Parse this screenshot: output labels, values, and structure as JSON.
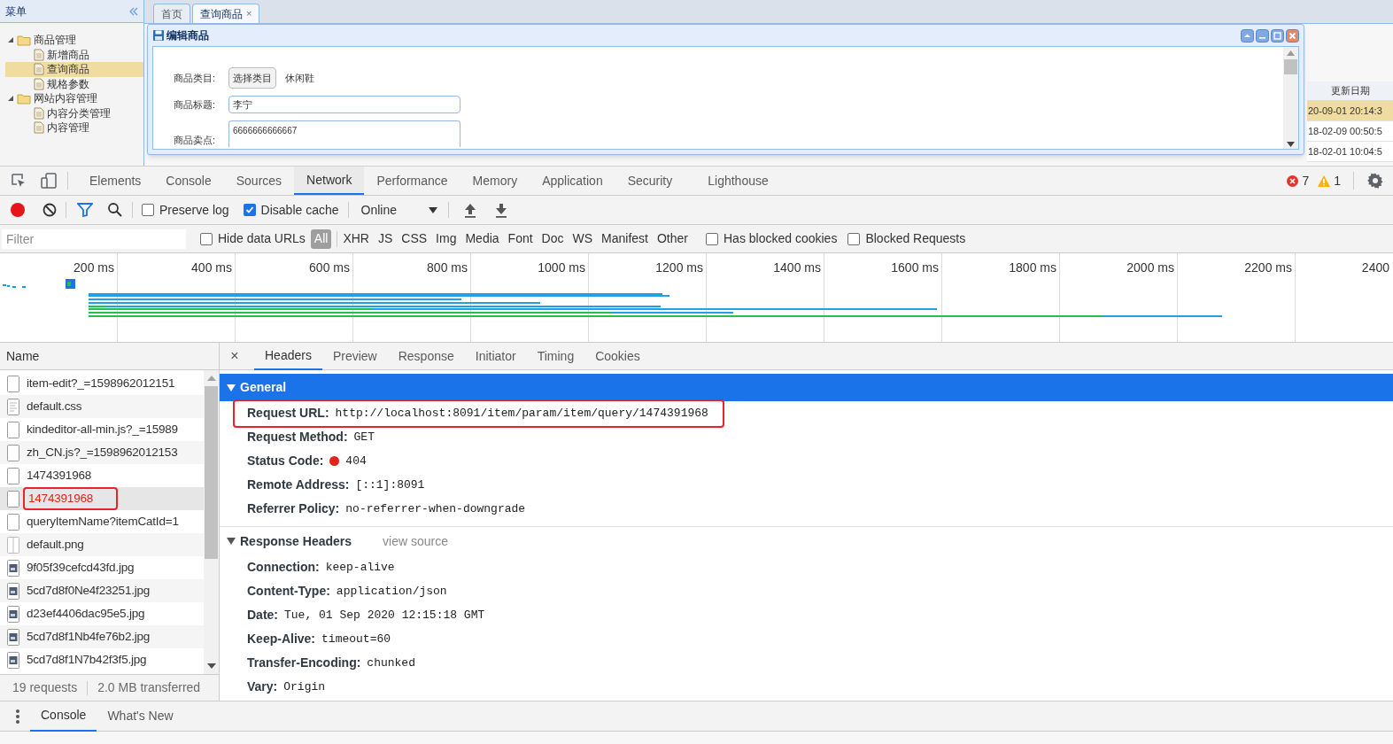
{
  "app": {
    "menu": {
      "title": "菜单"
    },
    "tree": [
      {
        "label": "商品管理",
        "expanded": true,
        "selected": false,
        "children": [
          {
            "label": "新增商品",
            "selected": false
          },
          {
            "label": "查询商品",
            "selected": true
          },
          {
            "label": "规格参数",
            "selected": false
          }
        ]
      },
      {
        "label": "网站内容管理",
        "expanded": true,
        "selected": false,
        "children": [
          {
            "label": "内容分类管理",
            "selected": false
          },
          {
            "label": "内容管理",
            "selected": false
          }
        ]
      }
    ],
    "tabs": [
      {
        "label": "首页",
        "selected": false
      },
      {
        "label": "查询商品",
        "selected": true,
        "close": "×"
      }
    ],
    "grid": {
      "column": "更新日期",
      "rows": [
        {
          "text": "20-09-01 20:14:3",
          "selected": true
        },
        {
          "text": "18-02-09 00:50:5",
          "selected": false
        },
        {
          "text": "18-02-01 10:04:5",
          "selected": false
        }
      ]
    },
    "dialog": {
      "title": "编辑商品",
      "fields": [
        {
          "kind": "category",
          "label": "商品类目:",
          "button": "选择类目",
          "value": "休闲鞋"
        },
        {
          "kind": "text",
          "label": "商品标题:",
          "value": "李宁"
        },
        {
          "kind": "textarea",
          "label": "商品卖点:",
          "value": "6666666666667"
        }
      ]
    }
  },
  "devtools": {
    "tabs": [
      {
        "label": "Elements",
        "selected": false
      },
      {
        "label": "Console",
        "selected": false
      },
      {
        "label": "Sources",
        "selected": false
      },
      {
        "label": "Network",
        "selected": true
      },
      {
        "label": "Performance",
        "selected": false
      },
      {
        "label": "Memory",
        "selected": false
      },
      {
        "label": "Application",
        "selected": false
      },
      {
        "label": "Security",
        "selected": false
      },
      {
        "label": "Lighthouse",
        "selected": false
      }
    ],
    "errors": "7",
    "warnings": "1",
    "toolbar": {
      "recording": true,
      "preserve_log": {
        "label": "Preserve log",
        "checked": false
      },
      "disable_cache": {
        "label": "Disable cache",
        "checked": true
      },
      "throttling": "Online"
    },
    "filter": {
      "placeholder": "Filter",
      "hide_data_urls": {
        "label": "Hide data URLs",
        "checked": false
      },
      "types": [
        {
          "label": "All",
          "selected": true
        },
        {
          "label": "XHR",
          "selected": false
        },
        {
          "label": "JS",
          "selected": false
        },
        {
          "label": "CSS",
          "selected": false
        },
        {
          "label": "Img",
          "selected": false
        },
        {
          "label": "Media",
          "selected": false
        },
        {
          "label": "Font",
          "selected": false
        },
        {
          "label": "Doc",
          "selected": false
        },
        {
          "label": "WS",
          "selected": false
        },
        {
          "label": "Manifest",
          "selected": false
        },
        {
          "label": "Other",
          "selected": false
        }
      ],
      "has_blocked_cookies": {
        "label": "Has blocked cookies",
        "checked": false
      },
      "blocked_requests": {
        "label": "Blocked Requests",
        "checked": false
      }
    },
    "timeline": {
      "ticks": [
        "200 ms",
        "400 ms",
        "600 ms",
        "800 ms",
        "1000 ms",
        "1200 ms",
        "1400 ms",
        "1600 ms",
        "1800 ms",
        "2000 ms",
        "2200 ms",
        "2400"
      ]
    },
    "requests": {
      "header": "Name",
      "rows": [
        {
          "name": "item-edit?_=1598962012151",
          "kind": "document",
          "error": false,
          "selected": false,
          "highlighted": false
        },
        {
          "name": "default.css",
          "kind": "stylesheet",
          "error": false,
          "selected": false,
          "highlighted": false
        },
        {
          "name": "kindeditor-all-min.js?_=15989",
          "kind": "document",
          "error": false,
          "selected": false,
          "highlighted": false
        },
        {
          "name": "zh_CN.js?_=1598962012153",
          "kind": "document",
          "error": false,
          "selected": false,
          "highlighted": false
        },
        {
          "name": "1474391968",
          "kind": "document",
          "error": false,
          "selected": false,
          "highlighted": false
        },
        {
          "name": "1474391968",
          "kind": "document",
          "error": true,
          "selected": true,
          "highlighted": true
        },
        {
          "name": "queryItemName?itemCatId=1",
          "kind": "document",
          "error": false,
          "selected": false,
          "highlighted": false
        },
        {
          "name": "default.png",
          "kind": "blank",
          "error": false,
          "selected": false,
          "highlighted": false
        },
        {
          "name": "9f05f39cefcd43fd.jpg",
          "kind": "image",
          "error": false,
          "selected": false,
          "highlighted": false
        },
        {
          "name": "5cd7d8f0Ne4f23251.jpg",
          "kind": "image",
          "error": false,
          "selected": false,
          "highlighted": false
        },
        {
          "name": "d23ef4406dac95e5.jpg",
          "kind": "image",
          "error": false,
          "selected": false,
          "highlighted": false
        },
        {
          "name": "5cd7d8f1Nb4fe76b2.jpg",
          "kind": "image",
          "error": false,
          "selected": false,
          "highlighted": false
        },
        {
          "name": "5cd7d8f1N7b42f3f5.jpg",
          "kind": "image",
          "error": false,
          "selected": false,
          "highlighted": false
        }
      ],
      "summary": [
        "19 requests",
        "2.0 MB transferred"
      ]
    },
    "details": {
      "close": "×",
      "tabs": [
        {
          "label": "Headers",
          "selected": true
        },
        {
          "label": "Preview",
          "selected": false
        },
        {
          "label": "Response",
          "selected": false
        },
        {
          "label": "Initiator",
          "selected": false
        },
        {
          "label": "Timing",
          "selected": false
        },
        {
          "label": "Cookies",
          "selected": false
        }
      ],
      "general": {
        "title": "General",
        "expanded": true,
        "rows": [
          {
            "name": "Request URL:",
            "value": "http://localhost:8091/item/param/item/query/1474391968",
            "highlighted": true
          },
          {
            "name": "Request Method:",
            "value": "GET",
            "highlighted": false
          },
          {
            "name": "Status Code:",
            "value": "404",
            "color": "#e2231a",
            "highlighted": false
          },
          {
            "name": "Remote Address:",
            "value": "[::1]:8091",
            "highlighted": false
          },
          {
            "name": "Referrer Policy:",
            "value": "no-referrer-when-downgrade",
            "highlighted": false
          }
        ]
      },
      "response_headers": {
        "title": "Response Headers",
        "expanded": true,
        "link": "view source",
        "rows": [
          {
            "name": "Connection:",
            "value": "keep-alive"
          },
          {
            "name": "Content-Type:",
            "value": "application/json"
          },
          {
            "name": "Date:",
            "value": "Tue, 01 Sep 2020 12:15:18 GMT"
          },
          {
            "name": "Keep-Alive:",
            "value": "timeout=60"
          },
          {
            "name": "Transfer-Encoding:",
            "value": "chunked"
          },
          {
            "name": "Vary:",
            "value": "Origin"
          }
        ]
      }
    },
    "drawer": {
      "tabs": [
        {
          "label": "Console",
          "selected": true
        },
        {
          "label": "What's New",
          "selected": false
        }
      ]
    }
  }
}
